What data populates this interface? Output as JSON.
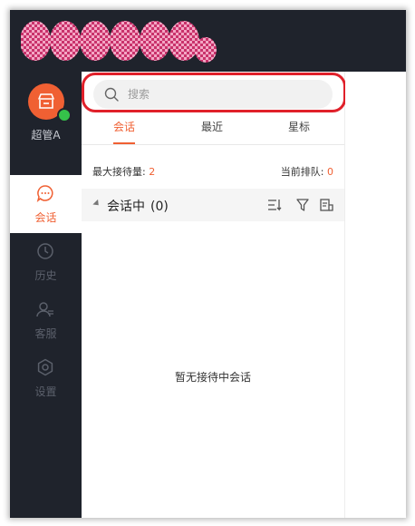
{
  "colors": {
    "accent": "#f06033",
    "sidebar_bg": "#1f232c",
    "online": "#35c24a",
    "highlight": "#e0202a"
  },
  "user": {
    "name": "超管A",
    "avatar_icon": "store-icon",
    "status": "online"
  },
  "nav": {
    "items": [
      {
        "label": "会话",
        "icon": "chat-icon",
        "active": true
      },
      {
        "label": "历史",
        "icon": "clock-icon",
        "active": false
      },
      {
        "label": "客服",
        "icon": "agent-icon",
        "active": false
      },
      {
        "label": "设置",
        "icon": "gear-icon",
        "active": false
      }
    ]
  },
  "search": {
    "placeholder": "搜索",
    "value": ""
  },
  "tabs": [
    {
      "label": "会话",
      "active": true
    },
    {
      "label": "最近",
      "active": false
    },
    {
      "label": "星标",
      "active": false
    }
  ],
  "stats": {
    "max_label": "最大接待量:",
    "max_value": "2",
    "queue_label": "当前排队:",
    "queue_value": "0"
  },
  "section": {
    "title": "会话中",
    "count": "(0)",
    "actions": [
      "sort-icon",
      "filter-icon",
      "export-icon"
    ]
  },
  "empty_message": "暂无接待中会话"
}
